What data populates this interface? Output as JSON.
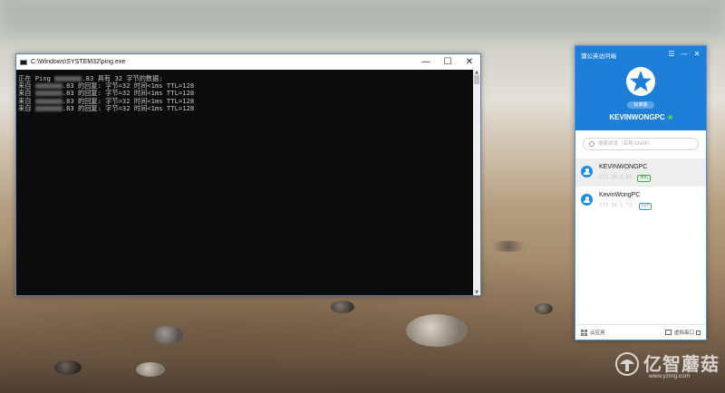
{
  "console": {
    "title": "C:\\Windows\\SYSTEM32\\ping.exe",
    "lines": [
      {
        "prefix": "正在 Ping ",
        "ip_tail": ".83",
        "suffix": " 具有 32 字节的数据:"
      },
      {
        "prefix": "来自 ",
        "ip_tail": ".83",
        "suffix": " 的回复: 字节=32 时间<1ms TTL=128"
      },
      {
        "prefix": "来自 ",
        "ip_tail": ".83",
        "suffix": " 的回复: 字节=32 时间<1ms TTL=128"
      },
      {
        "prefix": "来自 ",
        "ip_tail": ".83",
        "suffix": " 的回复: 字节=32 时间<1ms TTL=128"
      },
      {
        "prefix": "来自 ",
        "ip_tail": ".83",
        "suffix": " 的回复: 字节=32 时间<1ms TTL=128"
      }
    ]
  },
  "pgy": {
    "title": "蒲公英访问端",
    "badge": "标准版",
    "host_name": "KEVINWONGPC",
    "search_placeholder": "搜索成员（名称/SN/IP）",
    "devices": [
      {
        "name": "KEVINWONGPC",
        "ip": "172.16.1.83",
        "tag": "本机",
        "tag_color": "#3cb34a"
      },
      {
        "name": "KevinWongPC",
        "ip": "172.16.1.73",
        "tag": "P2P",
        "tag_color": "#4a8fe0"
      }
    ],
    "footer_left": "云应用",
    "footer_right": "虚拟串口"
  },
  "watermark": {
    "text": "亿智蘑菇",
    "url": "www.yzmg.com"
  },
  "colors": {
    "accent": "#1e7fd9",
    "online": "#3fd24b"
  }
}
